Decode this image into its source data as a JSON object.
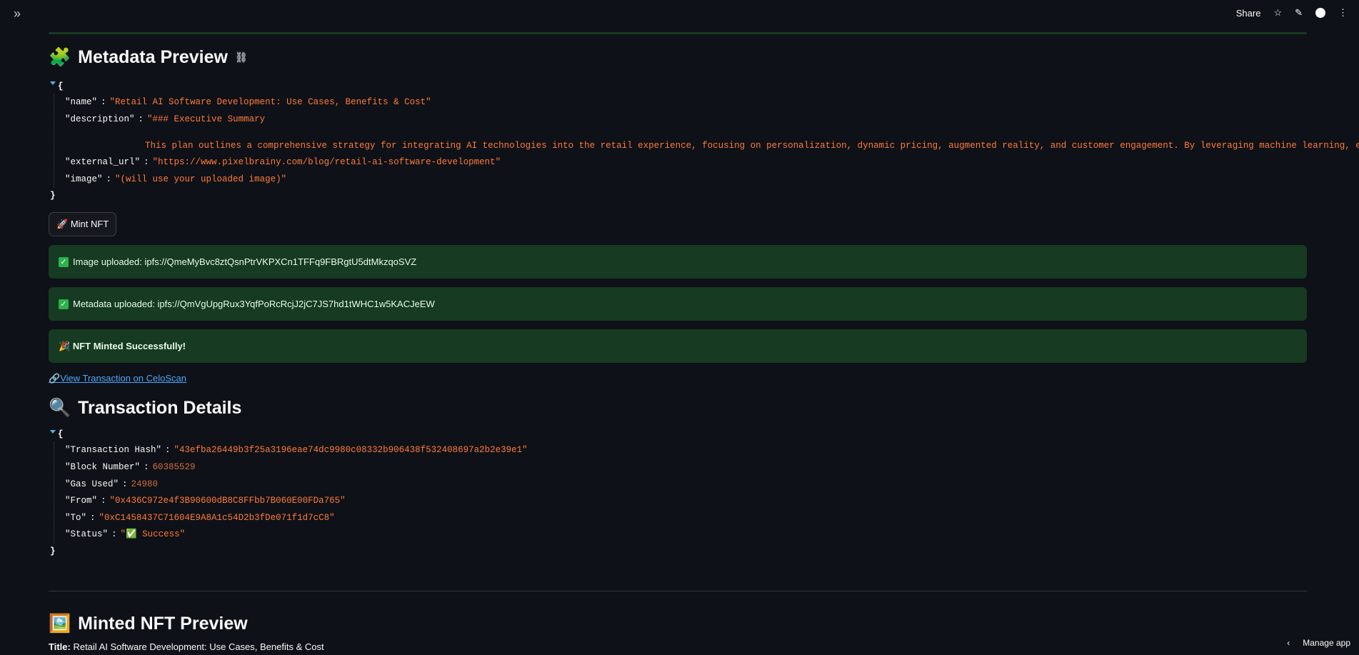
{
  "topbar": {
    "share_label": "Share",
    "star_icon": "☆",
    "edit_icon": "✎",
    "more_icon": "⋮"
  },
  "metadata_preview": {
    "title": "Metadata Preview",
    "emoji": "🧩",
    "rows": [
      {
        "key": "\"name\"",
        "value": "\"Retail AI Software Development: Use Cases, Benefits & Cost\""
      },
      {
        "key": "\"description\"",
        "value": "\"### Executive Summary"
      },
      {
        "key": "\"external_url\"",
        "value": "\"https://www.pixelbrainy.com/blog/retail-ai-software-development\""
      },
      {
        "key": "\"image\"",
        "value": "\"(will use your uploaded image)\""
      }
    ],
    "description_continuation": "This plan outlines a comprehensive strategy for integrating AI technologies into the retail experience, focusing on personalization, dynamic pricing, augmented reality, and customer engagement. By leveraging machine learning, e...\""
  },
  "mint_button": {
    "icon": "🚀",
    "label": "Mint NFT"
  },
  "alerts": {
    "image_uploaded": "Image uploaded: ipfs://QmeMyBvc8ztQsnPtrVKPXCn1TFFq9FBRgtU5dtMkzqoSVZ",
    "metadata_uploaded": "Metadata uploaded: ipfs://QmVgUpgRux3YqfPoRcRcjJ2jC7JS7hd1tWHC1w5KACJeEW",
    "minted_icon": "🎉",
    "minted": "NFT Minted Successfully!"
  },
  "tx_link": {
    "icon": "🔗",
    "label": "View Transaction on CeloScan"
  },
  "transaction_details": {
    "title": "Transaction Details",
    "emoji": "🔍",
    "rows": [
      {
        "key": "\"Transaction Hash\"",
        "value": "\"43efba26449b3f25a3196eae74dc9980c08332b906438f532408697a2b2e39e1\"",
        "type": "str"
      },
      {
        "key": "\"Block Number\"",
        "value": "60385529",
        "type": "num"
      },
      {
        "key": "\"Gas Used\"",
        "value": "24980",
        "type": "num"
      },
      {
        "key": "\"From\"",
        "value": "\"0x436C972e4f3B90600dB8C8FFbb7B060E00FDa765\"",
        "type": "str"
      },
      {
        "key": "\"To\"",
        "value": "\"0xC1458437C71604E9A8A1c54D2b3fDe071f1d7cC8\"",
        "type": "str"
      },
      {
        "key": "\"Status\"",
        "value": "\"✅ Success\"",
        "type": "str"
      }
    ]
  },
  "minted_preview": {
    "title": "Minted NFT Preview",
    "emoji": "🖼️",
    "title_label": "Title:",
    "title_value": "Retail AI Software Development: Use Cases, Benefits & Cost"
  },
  "bottom": {
    "manage_app": "Manage app"
  }
}
